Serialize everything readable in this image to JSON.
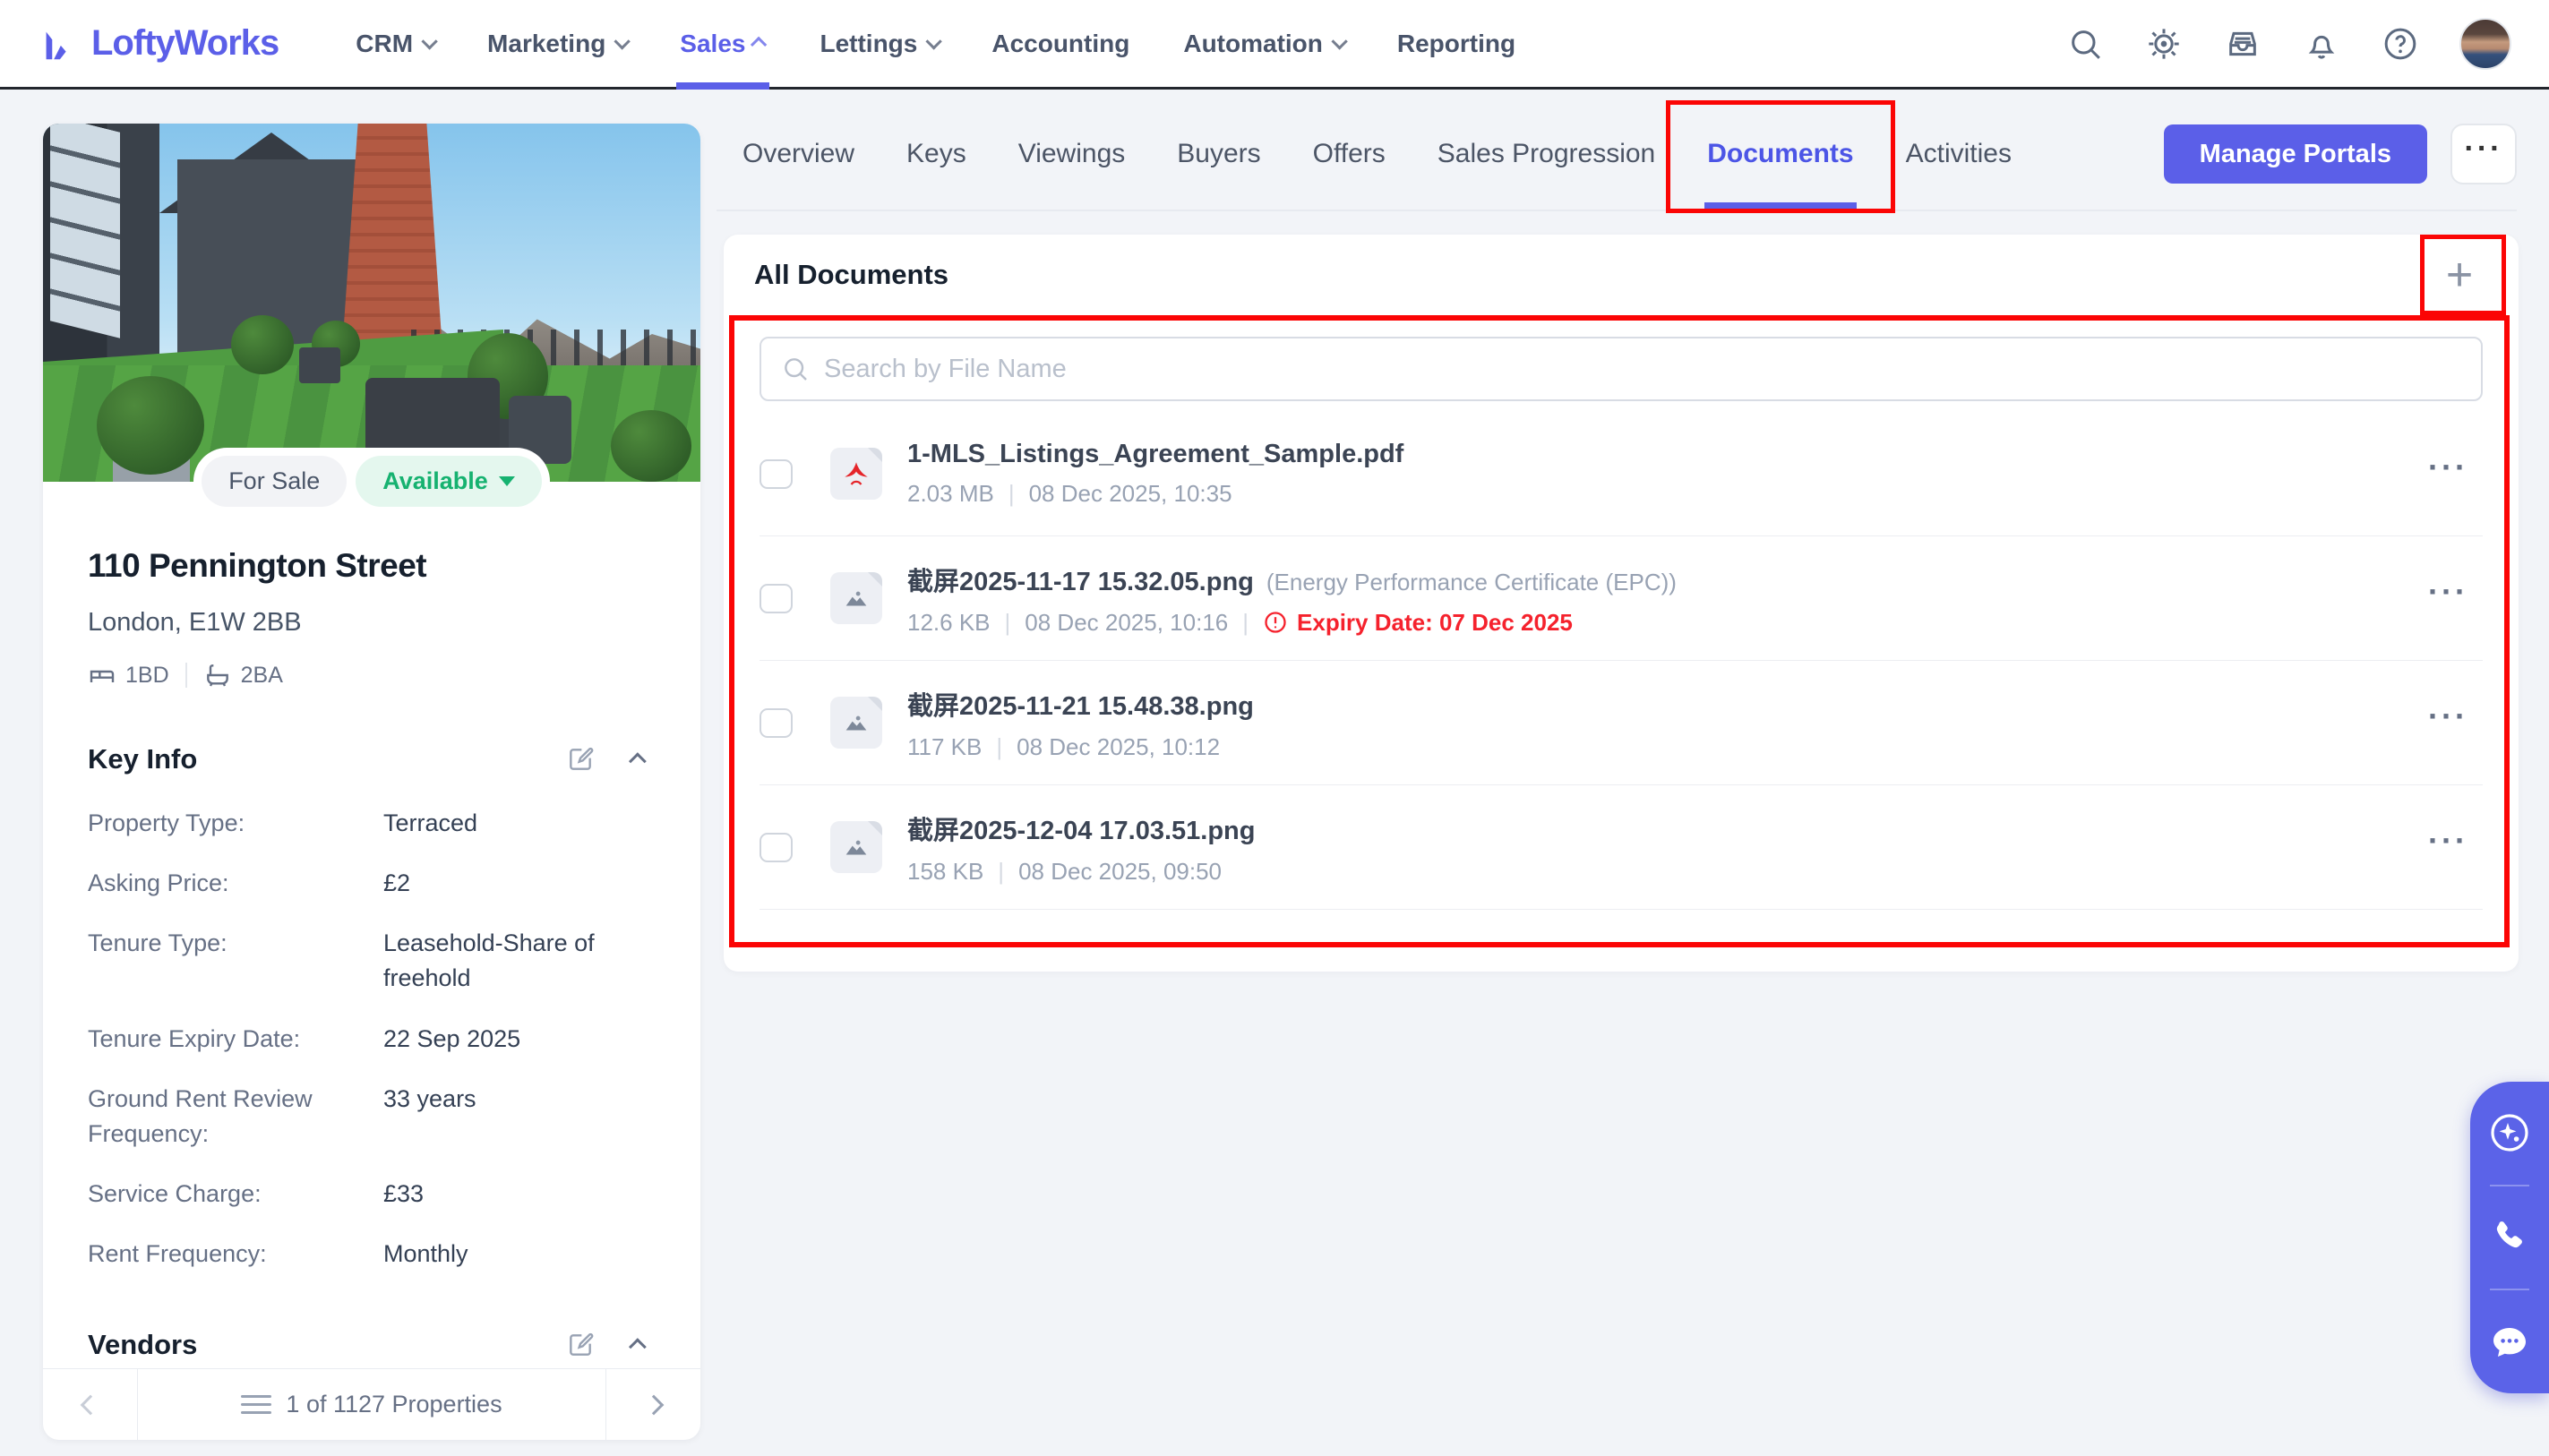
{
  "colors": {
    "accent": "#5b5fe8",
    "annotation_red": "#fb0505",
    "expiry_red": "#f5222d",
    "status_green": "#16b270",
    "page_bg": "#f2f4f8"
  },
  "header": {
    "brand": "LoftyWorks",
    "nav": [
      {
        "label": "CRM",
        "caret": "down",
        "state": "normal"
      },
      {
        "label": "Marketing",
        "caret": "down",
        "state": "normal"
      },
      {
        "label": "Sales",
        "caret": "up",
        "state": "active"
      },
      {
        "label": "Lettings",
        "caret": "down",
        "state": "normal"
      },
      {
        "label": "Accounting",
        "caret": "none",
        "state": "normal"
      },
      {
        "label": "Automation",
        "caret": "down",
        "state": "normal"
      },
      {
        "label": "Reporting",
        "caret": "none",
        "state": "normal"
      }
    ],
    "icons": [
      "search-icon",
      "gear-icon",
      "inbox-icon",
      "bell-icon",
      "help-icon",
      "avatar"
    ]
  },
  "tabs": [
    {
      "label": "Overview",
      "state": "normal",
      "annotated": ""
    },
    {
      "label": "Keys",
      "state": "normal",
      "annotated": ""
    },
    {
      "label": "Viewings",
      "state": "normal",
      "annotated": ""
    },
    {
      "label": "Buyers",
      "state": "normal",
      "annotated": ""
    },
    {
      "label": "Offers",
      "state": "normal",
      "annotated": ""
    },
    {
      "label": "Sales Progression",
      "state": "normal",
      "annotated": ""
    },
    {
      "label": "Documents",
      "state": "active",
      "annotated": "yes"
    },
    {
      "label": "Activities",
      "state": "normal",
      "annotated": ""
    }
  ],
  "actions": {
    "manage_portals_label": "Manage Portals",
    "more_label": "···"
  },
  "property": {
    "sale_badge": "For Sale",
    "status_badge": "Available",
    "title": "110 Pennington Street",
    "location": "London, E1W 2BB",
    "beds": "1BD",
    "baths": "2BA",
    "key_info_title": "Key Info",
    "key_info": [
      {
        "label": "Property Type:",
        "value": "Terraced"
      },
      {
        "label": "Asking Price:",
        "value": "£2"
      },
      {
        "label": "Tenure Type:",
        "value": "Leasehold-Share of freehold"
      },
      {
        "label": "Tenure Expiry Date:",
        "value": "22 Sep 2025"
      },
      {
        "label": "Ground Rent Review Frequency:",
        "value": "33 years"
      },
      {
        "label": "Service Charge:",
        "value": "£33"
      },
      {
        "label": "Rent Frequency:",
        "value": "Monthly"
      }
    ],
    "vendors_title": "Vendors",
    "pager_text": "1 of 1127 Properties"
  },
  "documents": {
    "title": "All Documents",
    "add_label": "+",
    "search_placeholder": "Search by File Name",
    "row_more": "···",
    "rows": [
      {
        "type": "pdf",
        "name": "1-MLS_Listings_Agreement_Sample.pdf",
        "note": "",
        "size": "2.03 MB",
        "date": "08 Dec 2025, 10:35",
        "expiry": ""
      },
      {
        "type": "image",
        "name": "截屏2025-11-17 15.32.05.png",
        "note": "(Energy Performance Certificate (EPC))",
        "size": "12.6 KB",
        "date": "08 Dec 2025, 10:16",
        "expiry": "Expiry Date: 07 Dec 2025"
      },
      {
        "type": "image",
        "name": "截屏2025-11-21 15.48.38.png",
        "note": "",
        "size": "117 KB",
        "date": "08 Dec 2025, 10:12",
        "expiry": ""
      },
      {
        "type": "image",
        "name": "截屏2025-12-04 17.03.51.png",
        "note": "",
        "size": "158 KB",
        "date": "08 Dec 2025, 09:50",
        "expiry": ""
      }
    ]
  },
  "dock": {
    "icons": [
      "ai-sparkle-icon",
      "phone-icon",
      "chat-icon"
    ]
  }
}
